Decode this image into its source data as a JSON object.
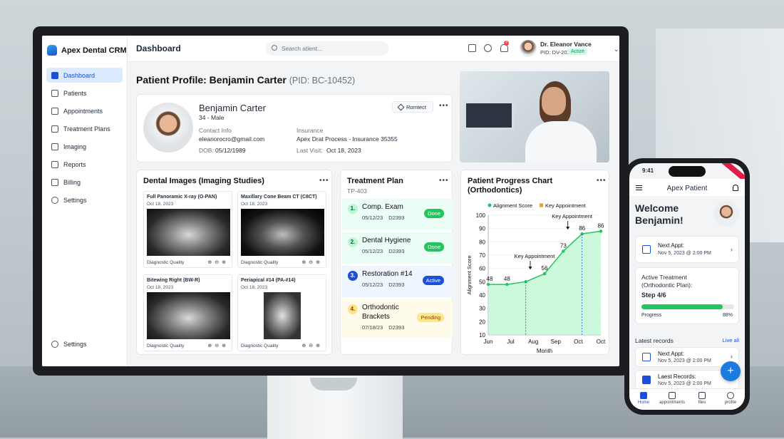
{
  "app": {
    "name": "Apex Dental CRM",
    "page_title": "Dashboard"
  },
  "sidebar": {
    "items": [
      {
        "label": "Dashboard",
        "icon": "dashboard-icon",
        "active": true
      },
      {
        "label": "Patients",
        "icon": "users-icon"
      },
      {
        "label": "Appointments",
        "icon": "calendar-icon"
      },
      {
        "label": "Treatment Plans",
        "icon": "clipboard-icon"
      },
      {
        "label": "Imaging",
        "icon": "image-icon"
      },
      {
        "label": "Reports",
        "icon": "report-icon"
      },
      {
        "label": "Billing",
        "icon": "billing-icon"
      },
      {
        "label": "Settings",
        "icon": "gear-icon"
      }
    ],
    "bottom_item": {
      "label": "Settings",
      "icon": "gear-icon"
    }
  },
  "topbar": {
    "search_placeholder": "Search atient...",
    "notification_count": "3",
    "user": {
      "name": "Dr. Eleanor Vance",
      "pid": "PID: DV-201",
      "status": "Actize"
    }
  },
  "profile": {
    "heading": "Patient Profile: Benjamin Carter",
    "heading_pid": "(PID: BC-10452)",
    "name": "Benjamin Carter",
    "age_sex": "34 - Male",
    "contact_label": "Contact Info",
    "email": "eleanorocro@gmail.com",
    "dob_label": "DOB:",
    "dob": "05/12/1989",
    "insurance_label": "Insurance",
    "insurance": "Apex Drat Process - Insurance 35355",
    "last_visit_label": "Last Visit:",
    "last_visit": "Oct 18, 2023",
    "contact_button": "Romtect"
  },
  "images": {
    "title": "Dental Images (Imaging Studies)",
    "items": [
      {
        "title": "Full Panoramic X-ray (O-PAN)",
        "date": "Oct 18, 2023",
        "quality": "Diagnostic Quality"
      },
      {
        "title": "Maxillary Cone Beam CT (C8CT)",
        "date": "Oct 18, 2023",
        "quality": "Diagnostic Quality"
      },
      {
        "title": "Bitewing Right (BW-R)",
        "date": "Oct 18, 2023",
        "quality": "Diagnostic Quality"
      },
      {
        "title": "Periapical #14 (PA-#14)",
        "date": "Oct 18, 2023",
        "quality": "Diagnostic Quality"
      }
    ]
  },
  "treatment": {
    "title": "Treatment Plan",
    "id": "TP-403",
    "items": [
      {
        "num": "1.",
        "name": "Comp. Exam",
        "date": "05/12/23",
        "code": "D2393",
        "status": "Done"
      },
      {
        "num": "2.",
        "name": "Dental Hygiene",
        "date": "05/12/23",
        "code": "D2393",
        "status": "Done"
      },
      {
        "num": "3.",
        "name": "Restoration #14",
        "date": "05/12/23",
        "code": "D2393",
        "status": "Active"
      },
      {
        "num": "4.",
        "name": "Orthodontic Brackets",
        "date": "07/18/23",
        "code": "D2393",
        "status": "Pending"
      }
    ]
  },
  "chart_data": {
    "type": "area",
    "title": "Patient Progress Chart (Orthodontics)",
    "xlabel": "Month",
    "ylabel": "Alignment Score",
    "x": [
      "Jun",
      "Jul",
      "Aug",
      "Aug",
      "Sep",
      "Oct",
      "Oct"
    ],
    "x_ticks": [
      "Jun",
      "Jul",
      "Aug",
      "Sep",
      "Oct",
      "Oct"
    ],
    "series": [
      {
        "name": "Alignment Score",
        "values": [
          48,
          48,
          50,
          56,
          73,
          86,
          88
        ]
      }
    ],
    "point_labels": [
      "48",
      "48",
      "",
      "56",
      "73",
      "86",
      "86"
    ],
    "y_ticks": [
      10,
      20,
      30,
      40,
      50,
      60,
      70,
      80,
      90,
      100
    ],
    "ylim": [
      10,
      100
    ],
    "annotations": [
      {
        "text": "Key Appointment",
        "label_point_index": 3,
        "line_point_index": 2
      },
      {
        "text": "Key Appointment",
        "label_point_index": 5,
        "line_point_index": 5
      }
    ],
    "legend": [
      "Alignment Score",
      "Key Appointment"
    ],
    "legend_position": "top",
    "colors": {
      "line": "#22c55e",
      "fill": "#bbf7d0",
      "key": "#f59e0b"
    }
  },
  "mobile": {
    "time": "9:41",
    "app_title": "Apex Patient",
    "welcome": "Welcome Benjamin!",
    "next_appt_label": "Next Appt:",
    "next_appt": "Nov 5, 2023 @ 2:00 PM",
    "active_treatment": "Active Treatment (Orthodontic Plan):",
    "step": "Step 4/6",
    "progress_label": "Progress",
    "progress_value": "88%",
    "progress_fraction": 0.88,
    "latest_label": "Latest records",
    "live_all": "Live all",
    "records": [
      {
        "label": "Next Appt:",
        "value": "Nov 5, 2023 @ 2:00 PM"
      },
      {
        "label": "Laest Records:",
        "value": "Nov 5, 2023 @ 2:00 PM"
      }
    ],
    "fab": "+",
    "nav": [
      {
        "label": "Home",
        "icon": "home-icon",
        "active": true
      },
      {
        "label": "appointments",
        "icon": "calendar-icon"
      },
      {
        "label": "files",
        "icon": "folder-icon"
      },
      {
        "label": "profile",
        "icon": "profile-icon"
      }
    ]
  }
}
